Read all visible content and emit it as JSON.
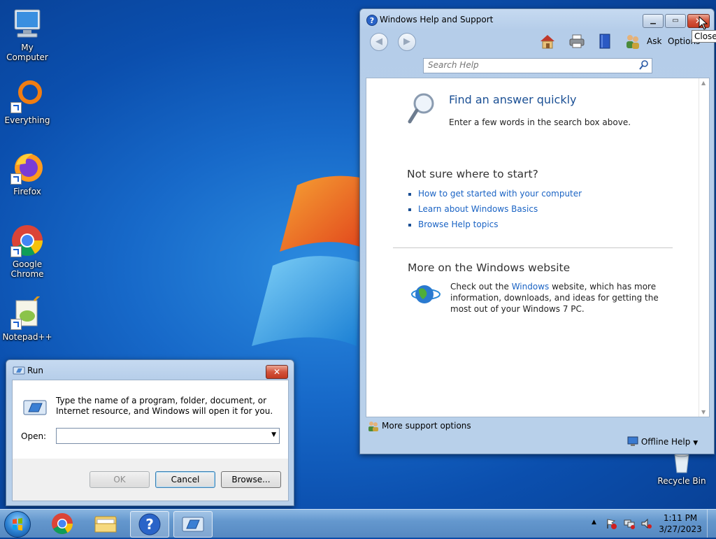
{
  "desktop": {
    "icons": [
      {
        "label": "My Computer"
      },
      {
        "label": "Everything"
      },
      {
        "label": "Firefox"
      },
      {
        "label": "Google Chrome"
      },
      {
        "label": "Notepad++"
      },
      {
        "label": "Recycle Bin"
      }
    ]
  },
  "help_window": {
    "title": "Windows Help and Support",
    "tooltip": "Close",
    "toolbar": {
      "ask_label": "Ask",
      "options_label": "Options"
    },
    "search_placeholder": "Search Help",
    "find_title": "Find an answer quickly",
    "find_subtitle": "Enter a few words in the search box above.",
    "not_sure_heading": "Not sure where to start?",
    "links": [
      "How to get started with your computer",
      "Learn about Windows Basics",
      "Browse Help topics"
    ],
    "more_heading": "More on the Windows website",
    "more_text_1": "Check out the ",
    "more_link": "Windows",
    "more_text_2": " website, which has more information, downloads, and ideas for getting the most out of your Windows 7 PC.",
    "more_support": "More support options",
    "offline_help": "Offline Help"
  },
  "run_dialog": {
    "title": "Run",
    "description": "Type the name of a program, folder, document, or Internet resource, and Windows will open it for you.",
    "open_label": "Open:",
    "open_value": "",
    "ok_label": "OK",
    "cancel_label": "Cancel",
    "browse_label": "Browse..."
  },
  "taskbar": {
    "time": "1:11 PM",
    "date": "3/27/2023"
  }
}
